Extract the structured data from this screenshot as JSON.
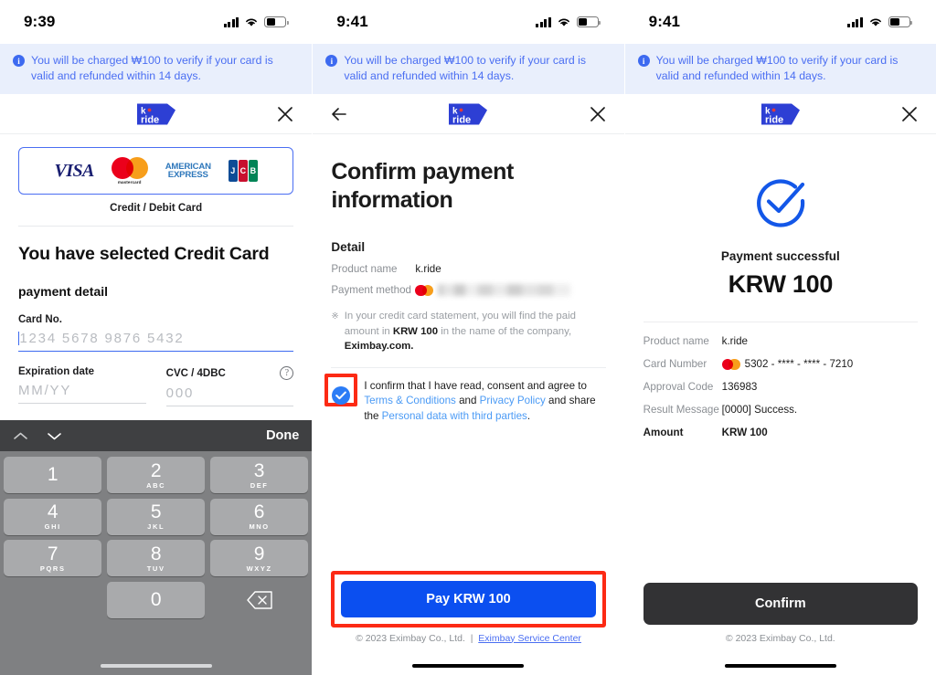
{
  "screens": [
    {
      "id": "card-entry",
      "status": {
        "time": "9:39"
      },
      "banner": {
        "icon": "info-icon",
        "text": "You will be charged ₩100 to verify if your card is valid and refunded within 14 days."
      },
      "appbar": {
        "logo": "k.ride",
        "close_label": "✕",
        "has_back": false
      },
      "card_brands": {
        "visa": "VISA",
        "mastercard": "mastercard",
        "amex_line1": "AMERICAN",
        "amex_line2": "EXPRESS",
        "jcb_j": "J",
        "jcb_c": "C",
        "jcb_b": "B",
        "caption": "Credit / Debit Card"
      },
      "heading": "You have selected Credit Card",
      "section_label": "payment detail",
      "fields": {
        "card_no": {
          "label": "Card No.",
          "value": "",
          "placeholder": "1234  5678  9876  5432"
        },
        "expiry": {
          "label": "Expiration date",
          "value": "",
          "placeholder": "MM/YY"
        },
        "cvc": {
          "label": "CVC / 4DBC",
          "value": "",
          "placeholder": "000",
          "help": "?"
        }
      },
      "keyboard": {
        "done_label": "Done",
        "up_icon": "chevron-up-icon",
        "down_icon": "chevron-down-icon",
        "keys": [
          {
            "num": "1",
            "sub": ""
          },
          {
            "num": "2",
            "sub": "ABC"
          },
          {
            "num": "3",
            "sub": "DEF"
          },
          {
            "num": "4",
            "sub": "GHI"
          },
          {
            "num": "5",
            "sub": "JKL"
          },
          {
            "num": "6",
            "sub": "MNO"
          },
          {
            "num": "7",
            "sub": "PQRS"
          },
          {
            "num": "8",
            "sub": "TUV"
          },
          {
            "num": "9",
            "sub": "WXYZ"
          },
          {
            "num": "0",
            "sub": ""
          }
        ],
        "delete_icon": "backspace-icon"
      }
    },
    {
      "id": "confirm-payment",
      "status": {
        "time": "9:41"
      },
      "banner": {
        "icon": "info-icon",
        "text": "You will be charged ₩100 to verify if your card is valid and refunded within 14 days."
      },
      "appbar": {
        "logo": "k.ride",
        "close_label": "✕",
        "has_back": true
      },
      "heading": "Confirm payment information",
      "detail_title": "Detail",
      "rows": [
        {
          "key": "Product name",
          "value": "k.ride",
          "type": "text"
        },
        {
          "key": "Payment method",
          "value": "",
          "type": "masked-card"
        }
      ],
      "note": {
        "marker": "※",
        "prefix": "In your credit card statement, you will find the paid amount in ",
        "amount": "KRW 100",
        "middle": " in the name of the company, ",
        "company": "Eximbay.com.",
        "suffix": ""
      },
      "consent": {
        "checked": true,
        "t1": "I confirm that I have read, consent and agree to ",
        "l1": "Terms & Conditions",
        "t2": " and ",
        "l2": "Privacy Policy",
        "t3": " and share the ",
        "l3": "Personal data with third parties",
        "t4": "."
      },
      "pay_button": "Pay KRW 100",
      "copyright": "© 2023 Eximbay Co., Ltd.",
      "copyright_sep": "|",
      "copyright_link": "Eximbay Service Center"
    },
    {
      "id": "payment-success",
      "status": {
        "time": "9:41"
      },
      "banner": {
        "icon": "info-icon",
        "text": "You will be charged ₩100 to verify if your card is valid and refunded within 14 days."
      },
      "appbar": {
        "logo": "k.ride",
        "close_label": "✕",
        "has_back": false
      },
      "success": {
        "icon": "check-circle-icon",
        "caption": "Payment successful",
        "amount": "KRW 100"
      },
      "rows": [
        {
          "key": "Product name",
          "value": "k.ride",
          "type": "text",
          "bold": false
        },
        {
          "key": "Card Number",
          "value": "5302 - **** - **** - 7210",
          "type": "card",
          "bold": false
        },
        {
          "key": "Approval Code",
          "value": "136983",
          "type": "text",
          "bold": false
        },
        {
          "key": "Result Message",
          "value": "[0000] Success.",
          "type": "text",
          "bold": false
        },
        {
          "key": "Amount",
          "value": "KRW 100",
          "type": "text",
          "bold": true
        }
      ],
      "confirm_button": "Confirm",
      "copyright": "© 2023 Eximbay Co., Ltd."
    }
  ],
  "colors": {
    "brand_blue": "#3d6af0",
    "banner_bg": "#e9effc",
    "banner_text": "#4a6ef2",
    "pay_button": "#0b4ff0",
    "confirm_button": "#323234",
    "highlight_red": "#fc2a14",
    "success_blue": "#1357e8"
  }
}
